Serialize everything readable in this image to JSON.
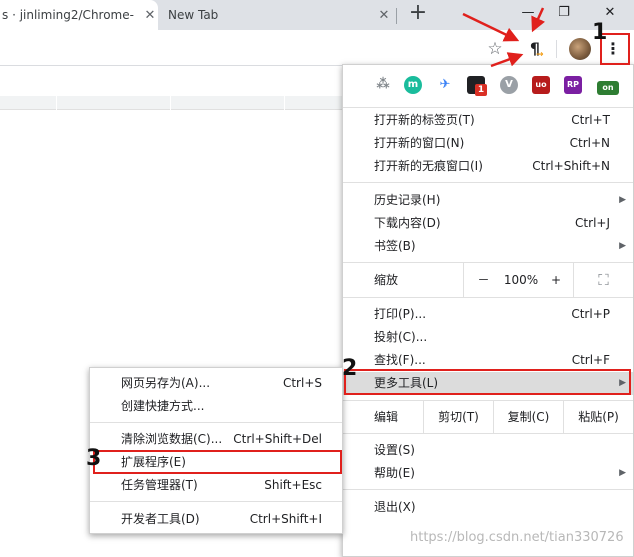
{
  "tabs": [
    {
      "title": "s · jinliming2/Chrome-",
      "close": "✕"
    },
    {
      "title": "New Tab",
      "close": "✕"
    }
  ],
  "newtab_symbol": "+",
  "window_controls": {
    "minimize": "—",
    "restore": "❐",
    "close": "✕"
  },
  "toolbar": {
    "star": "☆",
    "pilcrow": "¶",
    "menu": "⋮"
  },
  "extensions": [
    {
      "name": "network-icon",
      "symbol": "⁂",
      "color": "#9aa0a6"
    },
    {
      "name": "m-icon",
      "symbol": "m",
      "color": "#1abc9c"
    },
    {
      "name": "bird-icon",
      "symbol": "✈",
      "color": "#3b82f6"
    },
    {
      "name": "badge-extension-icon",
      "symbol": "■",
      "color": "#202124",
      "badge": "1"
    },
    {
      "name": "v-icon",
      "symbol": "V",
      "color": "#9aa0a6"
    },
    {
      "name": "ublock-icon",
      "symbol": "uo",
      "color": "#b71c1c"
    },
    {
      "name": "rp-icon",
      "symbol": "RP",
      "color": "#7b1fa2"
    },
    {
      "name": "on-icon",
      "symbol": "on",
      "color": "#2e7d32"
    }
  ],
  "menu": {
    "group1": [
      {
        "label": "打开新的标签页(T)",
        "key": "Ctrl+T"
      },
      {
        "label": "打开新的窗口(N)",
        "key": "Ctrl+N"
      },
      {
        "label": "打开新的无痕窗口(I)",
        "key": "Ctrl+Shift+N"
      }
    ],
    "group2": [
      {
        "label": "历史记录(H)",
        "key": ""
      },
      {
        "label": "下载内容(D)",
        "key": "Ctrl+J"
      },
      {
        "label": "书签(B)",
        "key": ""
      }
    ],
    "zoom": {
      "label": "缩放",
      "minus": "－",
      "value": "100%",
      "plus": "+",
      "fullscreen": "⛶"
    },
    "group3": [
      {
        "label": "打印(P)...",
        "key": "Ctrl+P"
      },
      {
        "label": "投射(C)...",
        "key": ""
      },
      {
        "label": "查找(F)...",
        "key": "Ctrl+F"
      },
      {
        "label": "更多工具(L)",
        "key": ""
      }
    ],
    "edit": {
      "label": "编辑",
      "cut": "剪切(T)",
      "copy": "复制(C)",
      "paste": "粘贴(P)"
    },
    "group4": [
      {
        "label": "设置(S)",
        "key": ""
      },
      {
        "label": "帮助(E)",
        "key": ""
      }
    ],
    "exit": "退出(X)",
    "arrow": "▶"
  },
  "submenu": {
    "group1": [
      {
        "label": "网页另存为(A)...",
        "key": "Ctrl+S"
      },
      {
        "label": "创建快捷方式...",
        "key": ""
      }
    ],
    "group2": [
      {
        "label": "清除浏览数据(C)...",
        "key": "Ctrl+Shift+Del"
      },
      {
        "label": "扩展程序(E)",
        "key": ""
      },
      {
        "label": "任务管理器(T)",
        "key": "Shift+Esc"
      }
    ],
    "group3": [
      {
        "label": "开发者工具(D)",
        "key": "Ctrl+Shift+I"
      }
    ]
  },
  "annotations": {
    "step1": "1",
    "step2": "2",
    "step3": "3",
    "color": "#e0201c"
  },
  "watermark": "https://blog.csdn.net/tian330726"
}
